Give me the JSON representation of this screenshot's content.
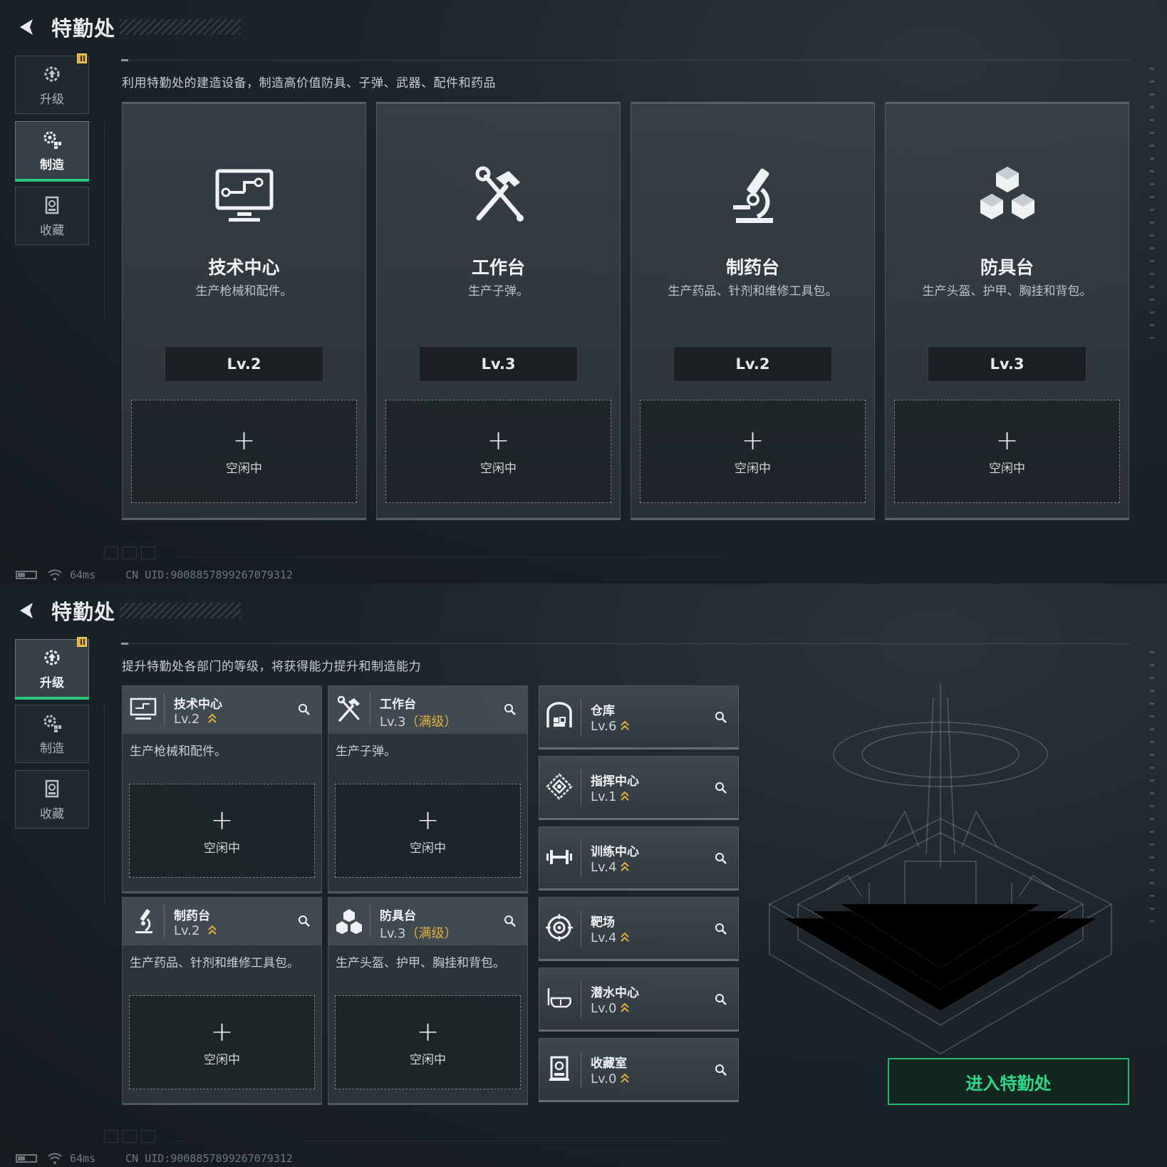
{
  "header": {
    "title": "特勤处"
  },
  "sidebar": {
    "items": [
      {
        "label": "升级"
      },
      {
        "label": "制造"
      },
      {
        "label": "收藏"
      }
    ]
  },
  "top": {
    "subtitle": "利用特勤处的建造设备，制造高价值防具、子弹、武器、配件和药品",
    "cards": [
      {
        "name": "技术中心",
        "desc": "生产枪械和配件。",
        "level": "Lv.2",
        "slot": "空闲中",
        "icon": "monitor-icon"
      },
      {
        "name": "工作台",
        "desc": "生产子弹。",
        "level": "Lv.3",
        "slot": "空闲中",
        "icon": "hammer-wrench-icon"
      },
      {
        "name": "制药台",
        "desc": "生产药品、针剂和维修工具包。",
        "level": "Lv.2",
        "slot": "空闲中",
        "icon": "microscope-icon"
      },
      {
        "name": "防具台",
        "desc": "生产头盔、护甲、胸挂和背包。",
        "level": "Lv.3",
        "slot": "空闲中",
        "icon": "cubes-icon"
      }
    ]
  },
  "bottom": {
    "subtitle": "提升特勤处各部门的等级，将获得能力提升和制造能力",
    "panels": [
      {
        "name": "技术中心",
        "level": "Lv.2",
        "max": "",
        "desc": "生产枪械和配件。",
        "slot": "空闲中"
      },
      {
        "name": "工作台",
        "level": "Lv.3",
        "max": "（满级）",
        "desc": "生产子弹。",
        "slot": "空闲中"
      },
      {
        "name": "制药台",
        "level": "Lv.2",
        "max": "",
        "desc": "生产药品、针剂和维修工具包。",
        "slot": "空闲中"
      },
      {
        "name": "防具台",
        "level": "Lv.3",
        "max": "（满级）",
        "desc": "生产头盔、护甲、胸挂和背包。",
        "slot": "空闲中"
      }
    ],
    "facilities": [
      {
        "name": "仓库",
        "level": "Lv.6",
        "icon": "warehouse-icon"
      },
      {
        "name": "指挥中心",
        "level": "Lv.1",
        "icon": "command-icon"
      },
      {
        "name": "训练中心",
        "level": "Lv.4",
        "icon": "dumbbell-icon"
      },
      {
        "name": "靶场",
        "level": "Lv.4",
        "icon": "target-icon"
      },
      {
        "name": "潜水中心",
        "level": "Lv.0",
        "icon": "dive-mask-icon"
      },
      {
        "name": "收藏室",
        "level": "Lv.0",
        "icon": "collection-icon"
      }
    ],
    "enter_label": "进入特勤处"
  },
  "footer": {
    "ping": "64ms",
    "uid": "CN UID:9008857899267079312"
  },
  "colors": {
    "accent_green": "#29c47a",
    "max_gold": "#e0b13c",
    "badge": "#e0b13c"
  }
}
